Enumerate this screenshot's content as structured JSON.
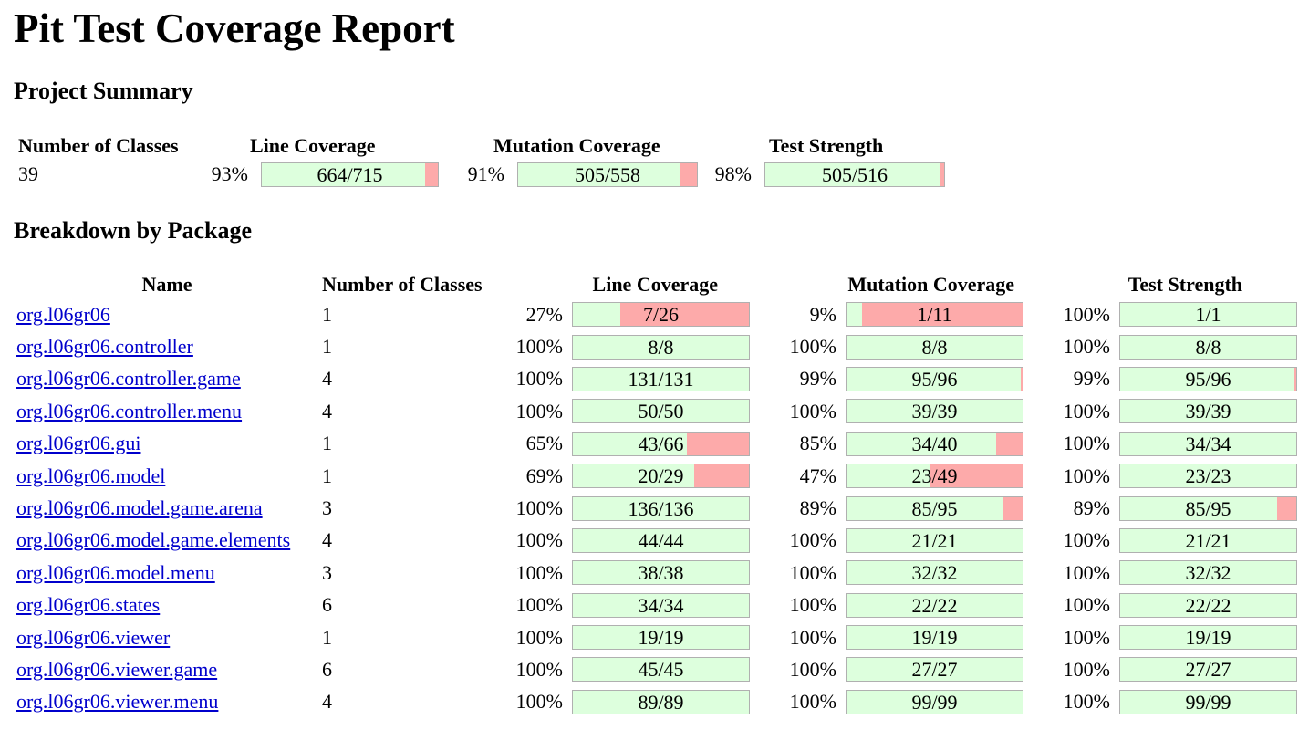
{
  "title": "Pit Test Coverage Report",
  "project_summary": {
    "heading": "Project Summary",
    "columns": [
      "Number of Classes",
      "Line Coverage",
      "Mutation Coverage",
      "Test Strength"
    ],
    "classes": "39",
    "line": {
      "pct": "93%",
      "text": "664/715",
      "fraction": 0.93
    },
    "mutation": {
      "pct": "91%",
      "text": "505/558",
      "fraction": 0.91
    },
    "strength": {
      "pct": "98%",
      "text": "505/516",
      "fraction": 0.98
    }
  },
  "breakdown": {
    "heading": "Breakdown by Package",
    "columns": [
      "Name",
      "Number of Classes",
      "Line Coverage",
      "Mutation Coverage",
      "Test Strength"
    ],
    "rows": [
      {
        "name": "org.l06gr06",
        "classes": "1",
        "line": {
          "pct": "27%",
          "text": "7/26",
          "fraction": 0.27
        },
        "mutation": {
          "pct": "9%",
          "text": "1/11",
          "fraction": 0.09
        },
        "strength": {
          "pct": "100%",
          "text": "1/1",
          "fraction": 1.0
        }
      },
      {
        "name": "org.l06gr06.controller",
        "classes": "1",
        "line": {
          "pct": "100%",
          "text": "8/8",
          "fraction": 1.0
        },
        "mutation": {
          "pct": "100%",
          "text": "8/8",
          "fraction": 1.0
        },
        "strength": {
          "pct": "100%",
          "text": "8/8",
          "fraction": 1.0
        }
      },
      {
        "name": "org.l06gr06.controller.game",
        "classes": "4",
        "line": {
          "pct": "100%",
          "text": "131/131",
          "fraction": 1.0
        },
        "mutation": {
          "pct": "99%",
          "text": "95/96",
          "fraction": 0.99
        },
        "strength": {
          "pct": "99%",
          "text": "95/96",
          "fraction": 0.99
        }
      },
      {
        "name": "org.l06gr06.controller.menu",
        "classes": "4",
        "line": {
          "pct": "100%",
          "text": "50/50",
          "fraction": 1.0
        },
        "mutation": {
          "pct": "100%",
          "text": "39/39",
          "fraction": 1.0
        },
        "strength": {
          "pct": "100%",
          "text": "39/39",
          "fraction": 1.0
        }
      },
      {
        "name": "org.l06gr06.gui",
        "classes": "1",
        "line": {
          "pct": "65%",
          "text": "43/66",
          "fraction": 0.65
        },
        "mutation": {
          "pct": "85%",
          "text": "34/40",
          "fraction": 0.85
        },
        "strength": {
          "pct": "100%",
          "text": "34/34",
          "fraction": 1.0
        }
      },
      {
        "name": "org.l06gr06.model",
        "classes": "1",
        "line": {
          "pct": "69%",
          "text": "20/29",
          "fraction": 0.69
        },
        "mutation": {
          "pct": "47%",
          "text": "23/49",
          "fraction": 0.47
        },
        "strength": {
          "pct": "100%",
          "text": "23/23",
          "fraction": 1.0
        }
      },
      {
        "name": "org.l06gr06.model.game.arena",
        "classes": "3",
        "line": {
          "pct": "100%",
          "text": "136/136",
          "fraction": 1.0
        },
        "mutation": {
          "pct": "89%",
          "text": "85/95",
          "fraction": 0.89
        },
        "strength": {
          "pct": "89%",
          "text": "85/95",
          "fraction": 0.89
        }
      },
      {
        "name": "org.l06gr06.model.game.elements",
        "classes": "4",
        "line": {
          "pct": "100%",
          "text": "44/44",
          "fraction": 1.0
        },
        "mutation": {
          "pct": "100%",
          "text": "21/21",
          "fraction": 1.0
        },
        "strength": {
          "pct": "100%",
          "text": "21/21",
          "fraction": 1.0
        }
      },
      {
        "name": "org.l06gr06.model.menu",
        "classes": "3",
        "line": {
          "pct": "100%",
          "text": "38/38",
          "fraction": 1.0
        },
        "mutation": {
          "pct": "100%",
          "text": "32/32",
          "fraction": 1.0
        },
        "strength": {
          "pct": "100%",
          "text": "32/32",
          "fraction": 1.0
        }
      },
      {
        "name": "org.l06gr06.states",
        "classes": "6",
        "line": {
          "pct": "100%",
          "text": "34/34",
          "fraction": 1.0
        },
        "mutation": {
          "pct": "100%",
          "text": "22/22",
          "fraction": 1.0
        },
        "strength": {
          "pct": "100%",
          "text": "22/22",
          "fraction": 1.0
        }
      },
      {
        "name": "org.l06gr06.viewer",
        "classes": "1",
        "line": {
          "pct": "100%",
          "text": "19/19",
          "fraction": 1.0
        },
        "mutation": {
          "pct": "100%",
          "text": "19/19",
          "fraction": 1.0
        },
        "strength": {
          "pct": "100%",
          "text": "19/19",
          "fraction": 1.0
        }
      },
      {
        "name": "org.l06gr06.viewer.game",
        "classes": "6",
        "line": {
          "pct": "100%",
          "text": "45/45",
          "fraction": 1.0
        },
        "mutation": {
          "pct": "100%",
          "text": "27/27",
          "fraction": 1.0
        },
        "strength": {
          "pct": "100%",
          "text": "27/27",
          "fraction": 1.0
        }
      },
      {
        "name": "org.l06gr06.viewer.menu",
        "classes": "4",
        "line": {
          "pct": "100%",
          "text": "89/89",
          "fraction": 1.0
        },
        "mutation": {
          "pct": "100%",
          "text": "99/99",
          "fraction": 1.0
        },
        "strength": {
          "pct": "100%",
          "text": "99/99",
          "fraction": 1.0
        }
      }
    ]
  },
  "colors": {
    "covered": "#ddffdd",
    "uncovered": "#fdaaaa",
    "link": "#0000cc"
  }
}
